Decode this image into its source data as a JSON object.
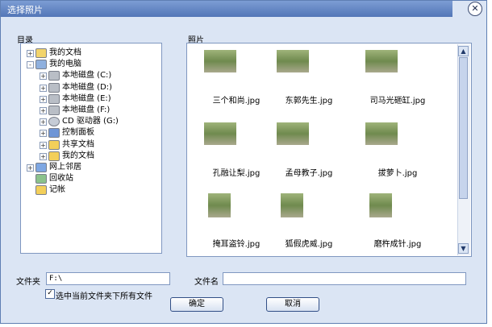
{
  "dialog": {
    "title": "选择照片",
    "close_glyph": "✕"
  },
  "tree": {
    "label": "目录",
    "items": [
      {
        "label": "我的文档",
        "icon": "documents-icon",
        "exp": "+"
      },
      {
        "label": "我的电脑",
        "icon": "computer-icon",
        "exp": "-"
      },
      {
        "label": "本地磁盘 (C:)",
        "icon": "drive-icon",
        "exp": "+"
      },
      {
        "label": "本地磁盘 (D:)",
        "icon": "drive-icon",
        "exp": "+"
      },
      {
        "label": "本地磁盘 (E:)",
        "icon": "drive-icon",
        "exp": "+"
      },
      {
        "label": "本地磁盘 (F:)",
        "icon": "drive-icon",
        "exp": "+"
      },
      {
        "label": "CD 驱动器 (G:)",
        "icon": "cd-drive-icon",
        "exp": "+"
      },
      {
        "label": "控制面板",
        "icon": "control-panel-icon",
        "exp": "+"
      },
      {
        "label": "共享文档",
        "icon": "folder-icon",
        "exp": "+"
      },
      {
        "label": "我的文档",
        "icon": "folder-icon",
        "exp": "+"
      },
      {
        "label": "网上邻居",
        "icon": "network-icon",
        "exp": "+"
      },
      {
        "label": "回收站",
        "icon": "recycle-bin-icon",
        "exp": ""
      },
      {
        "label": "记帐",
        "icon": "folder-icon",
        "exp": ""
      }
    ]
  },
  "photos": {
    "label": "照片",
    "files": [
      "三个和尚.jpg",
      "东郭先生.jpg",
      "司马光砸缸.jpg",
      "孔融让梨.jpg",
      "孟母教子.jpg",
      "拔萝卜.jpg",
      "掩耳盗铃.jpg",
      "狐假虎威.jpg",
      "磨杵成针.jpg"
    ]
  },
  "folder_field": {
    "label": "文件夹",
    "value": "F:\\"
  },
  "filename_field": {
    "label": "文件名",
    "value": ""
  },
  "include_subfolders": {
    "label": "选中当前文件夹下所有文件",
    "checked": true,
    "check_glyph": "✓"
  },
  "buttons": {
    "ok": "确定",
    "cancel": "取消"
  },
  "scroll": {
    "up": "▲",
    "down": "▼"
  }
}
